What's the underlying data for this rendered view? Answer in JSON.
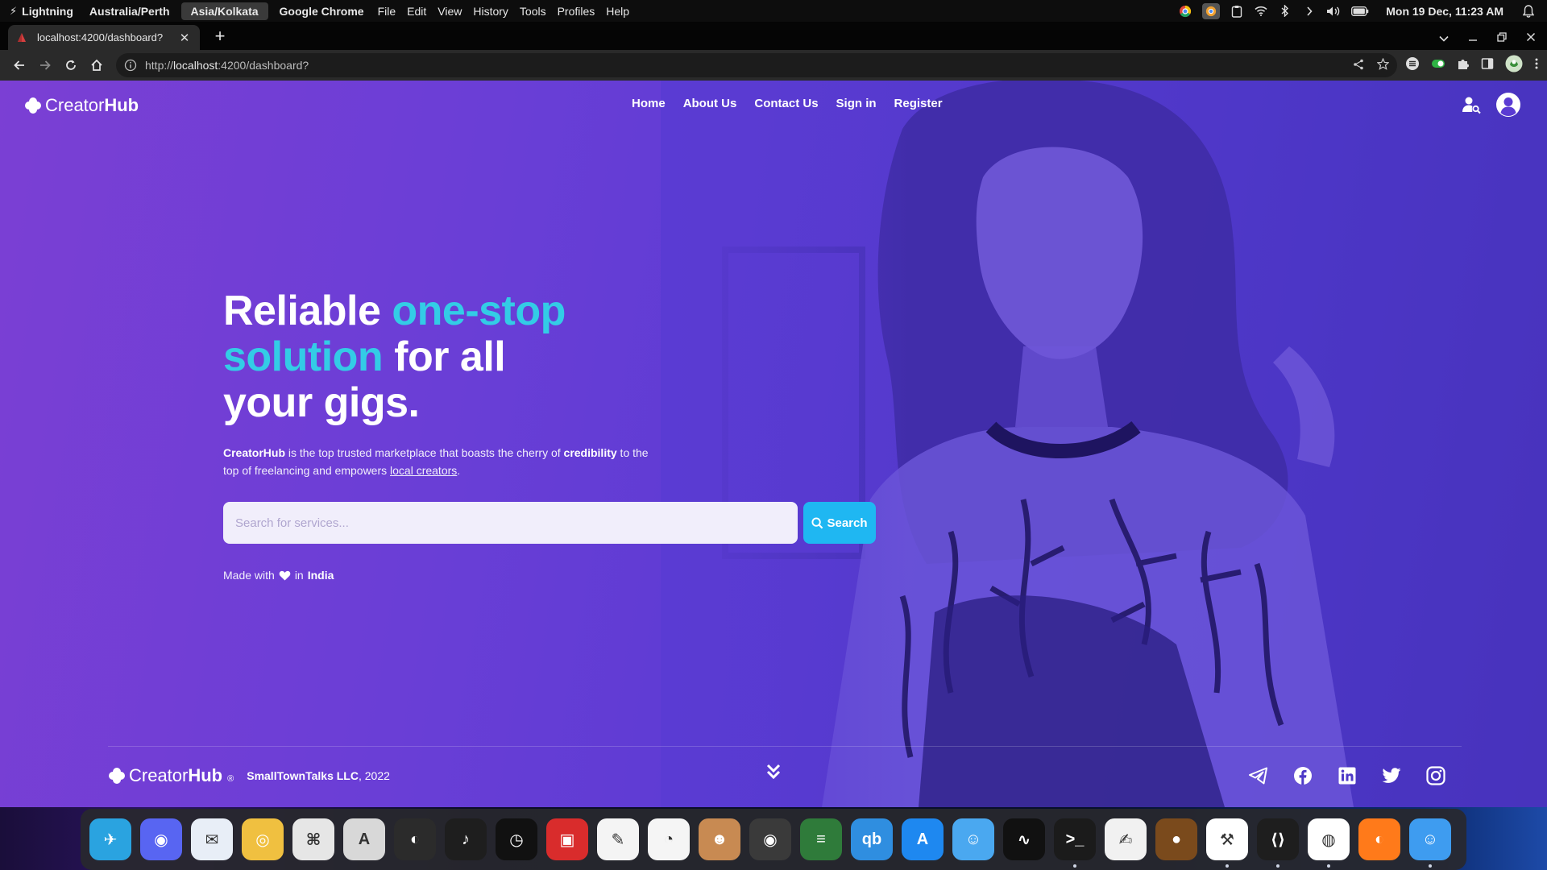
{
  "menubar": {
    "bolt": "⚡",
    "app1": "Lightning",
    "tz1": "Australia/Perth",
    "tz2": "Asia/Kolkata",
    "active_app": "Google Chrome",
    "menus": [
      "File",
      "Edit",
      "View",
      "History",
      "Tools",
      "Profiles",
      "Help"
    ],
    "clock": "Mon 19 Dec, 11:23 AM"
  },
  "browser": {
    "tab_title": "localhost:4200/dashboard?",
    "url_prefix": "http://",
    "url_host": "localhost",
    "url_rest": ":4200/dashboard?"
  },
  "page": {
    "brand_part1": "Creator",
    "brand_part2": "Hub",
    "nav": [
      "Home",
      "About Us",
      "Contact Us",
      "Sign in",
      "Register"
    ],
    "headline": {
      "w1": "Reliable ",
      "w2": "one-stop",
      "w3": "solution",
      "w4": " for all",
      "w5": "your gigs."
    },
    "desc": {
      "brand": "CreatorHub",
      "t1": " is the top trusted marketplace that boasts the cherry of ",
      "cred": "credibility",
      "t2": " to the top of freelancing and empowers ",
      "link": "local creators",
      "t3": "."
    },
    "search_placeholder": "Search for services...",
    "search_button": "Search",
    "made_prefix": "Made with",
    "made_mid": "in",
    "made_country": "India",
    "footer": {
      "reg": "®",
      "company": "SmallTownTalks LLC",
      "year": ", 2022"
    }
  },
  "colors": {
    "accent": "#33cce6",
    "search_button": "#1fb7f2"
  },
  "dock_apps": [
    {
      "name": "Telegram",
      "color": "#2aa3e0",
      "glyph": "✈",
      "dot": false
    },
    {
      "name": "Discord",
      "color": "#5865f2",
      "glyph": "◉",
      "dot": false
    },
    {
      "name": "Thunderbird",
      "color": "#e8eef7",
      "glyph": "✉",
      "dot": false
    },
    {
      "name": "Photo Booth",
      "color": "#f0c040",
      "glyph": "◎",
      "dot": false
    },
    {
      "name": "Keyboard Shortcuts",
      "color": "#e6e6e6",
      "glyph": "⌘",
      "dot": false
    },
    {
      "name": "Font Book",
      "color": "#d8d8d8",
      "glyph": "A",
      "dot": false
    },
    {
      "name": "OBS",
      "color": "#2b2b2b",
      "glyph": "◐",
      "dot": false
    },
    {
      "name": "Voice Recorder",
      "color": "#1e1e1e",
      "glyph": "♪",
      "dot": false
    },
    {
      "name": "Clock",
      "color": "#111111",
      "glyph": "◷",
      "dot": false
    },
    {
      "name": "Photo Booth Red",
      "color": "#d92c2c",
      "glyph": "▣",
      "dot": false
    },
    {
      "name": "Paintbrush",
      "color": "#f4f4f4",
      "glyph": "✎",
      "dot": false
    },
    {
      "name": "Blender",
      "color": "#f5f5f5",
      "glyph": "◔",
      "dot": false
    },
    {
      "name": "GIMP",
      "color": "#c88a52",
      "glyph": "☻",
      "dot": false
    },
    {
      "name": "Screenshot",
      "color": "#3a3a3a",
      "glyph": "◉",
      "dot": false
    },
    {
      "name": "Stacks",
      "color": "#2f7b3a",
      "glyph": "≡",
      "dot": false
    },
    {
      "name": "qBittorrent",
      "color": "#2f8ee0",
      "glyph": "qb",
      "dot": false
    },
    {
      "name": "App Store",
      "color": "#1e88f0",
      "glyph": "A",
      "dot": false
    },
    {
      "name": "Finder",
      "color": "#4aa8f0",
      "glyph": "☺",
      "dot": false
    },
    {
      "name": "Activity Monitor",
      "color": "#111111",
      "glyph": "∿",
      "dot": false
    },
    {
      "name": "Terminal",
      "color": "#1b1b1b",
      "glyph": ">_",
      "dot": true
    },
    {
      "name": "TextEdit",
      "color": "#f1f1f1",
      "glyph": "✍",
      "dot": false
    },
    {
      "name": "Acorn",
      "color": "#7a4a1c",
      "glyph": "●",
      "dot": false
    },
    {
      "name": "Xcode",
      "color": "#ffffff",
      "glyph": "⚒",
      "dot": true
    },
    {
      "name": "VS Code",
      "color": "#1e1e1e",
      "glyph": "⟨⟩",
      "dot": true
    },
    {
      "name": "Google Chrome",
      "color": "#ffffff",
      "glyph": "◍",
      "dot": true
    },
    {
      "name": "Firefox",
      "color": "#ff7a1a",
      "glyph": "◐",
      "dot": false
    },
    {
      "name": "Finder 2",
      "color": "#3e9cf0",
      "glyph": "☺",
      "dot": true
    }
  ]
}
